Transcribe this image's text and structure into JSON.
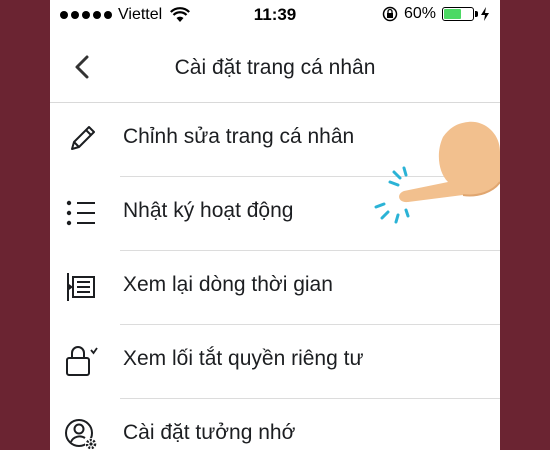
{
  "status_bar": {
    "carrier": "Viettel",
    "time": "11:39",
    "battery_percent": "60%",
    "battery_level": 0.6
  },
  "navbar": {
    "title": "Cài đặt trang cá nhân",
    "back_icon": "chevron-left-icon"
  },
  "menu": {
    "items": [
      {
        "label": "Chỉnh sửa trang cá nhân",
        "icon": "pencil-icon"
      },
      {
        "label": "Nhật ký hoạt động",
        "icon": "list-icon"
      },
      {
        "label": "Xem lại dòng thời gian",
        "icon": "timeline-review-icon"
      },
      {
        "label": "Xem lối tắt quyền riêng tư",
        "icon": "lock-icon"
      },
      {
        "label": "Cài đặt tưởng nhớ",
        "icon": "memorial-settings-icon"
      }
    ]
  },
  "colors": {
    "background": "#6b2432",
    "battery": "#4cd964",
    "text": "#1c1e21",
    "tap_indicator": "#2bb3d6"
  }
}
